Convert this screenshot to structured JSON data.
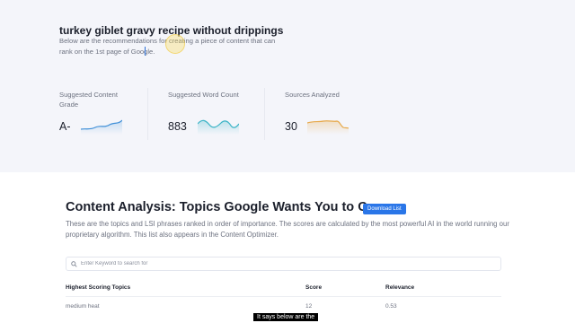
{
  "header": {
    "query_title": "turkey giblet gravy recipe without drippings",
    "description": "Below are the recommendations for creating a piece of content that can rank on the 1st page of Google."
  },
  "metrics": [
    {
      "label": "Suggested Content Grade",
      "value": "A-",
      "spark_color": "#3f8fd8"
    },
    {
      "label": "Suggested Word Count",
      "value": "883",
      "spark_color": "#39b3c6"
    },
    {
      "label": "Sources Analyzed",
      "value": "30",
      "spark_color": "#e7a94a"
    }
  ],
  "analysis": {
    "title": "Content Analysis: Topics Google Wants You to Cover",
    "download_label": "Download List",
    "description": "These are the topics and LSI phrases ranked in order of importance. The scores are calculated by the most powerful AI in the world running our proprietary algorithm. This list also appears in the Content Optimizer."
  },
  "search": {
    "placeholder": "Enter Keyword to search for",
    "value": ""
  },
  "table": {
    "headers": [
      "Highest Scoring Topics",
      "Score",
      "Relevance"
    ],
    "rows": [
      {
        "topic": "medium heat",
        "score": "12",
        "relevance": "0.53"
      }
    ]
  },
  "caption": "It says below are the",
  "colors": {
    "accent": "#2a76e8",
    "top_background": "#f4f5fa"
  }
}
